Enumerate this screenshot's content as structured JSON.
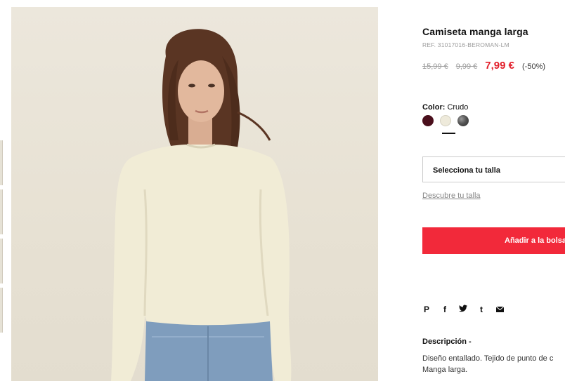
{
  "product": {
    "title": "Camiseta manga larga",
    "ref": "REF. 31017016-BEROMAN-LM",
    "prices": {
      "original": "15,99 €",
      "previous": "9,99 €",
      "current": "7,99 €",
      "discount": "(-50%)"
    },
    "color": {
      "label": "Color:",
      "selected": "Crudo",
      "swatches": [
        "#4a0f1c",
        "#eeeadb",
        "#3a3a3a"
      ]
    },
    "size_select_label": "Selecciona tu talla",
    "size_guide_link": "Descubre tu talla",
    "add_to_bag": "Añadir a la bolsa",
    "share_icons": [
      "pinterest-icon",
      "facebook-icon",
      "twitter-icon",
      "tumblr-icon",
      "mail-icon"
    ],
    "description_heading": "Descripción -",
    "description_lines": [
      "Diseño entallado. Tejido de punto de c",
      "Manga larga."
    ]
  },
  "colors": {
    "accent": "#f2293a",
    "sale": "#e2202c"
  }
}
